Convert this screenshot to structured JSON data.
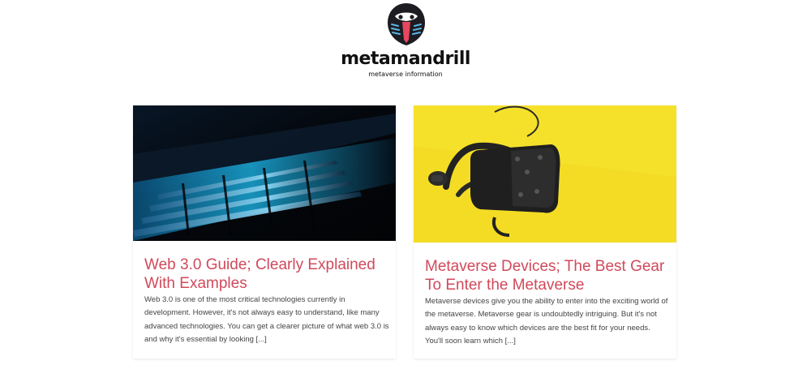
{
  "brand": {
    "name": "metamandrill",
    "tagline": "metaverse information"
  },
  "posts": [
    {
      "title": "Web 3.0 Guide; Clearly Explained With Examples",
      "excerpt": "Web 3.0 is one of the most critical technologies currently in development. However, it's not always easy to understand, like many advanced technologies. You can get a clearer picture of what web 3.0 is and why it's essential by looking",
      "read_more": "[...]",
      "image_icon": "laptop-keyboard-image"
    },
    {
      "title": "Metaverse Devices; The Best Gear To Enter the Metaverse",
      "excerpt": "Metaverse devices give you the ability to enter into the exciting world of the metaverse. Metaverse gear is undoubtedly intriguing. But it's not always easy to know which devices are the best fit for your needs. You'll soon learn which",
      "read_more": "[...]",
      "image_icon": "vr-headset-image"
    }
  ],
  "colors": {
    "accent": "#d1495b",
    "text": "#444444",
    "card_right_bg": "#f6e12a",
    "card_left_bg": "#050a12"
  }
}
